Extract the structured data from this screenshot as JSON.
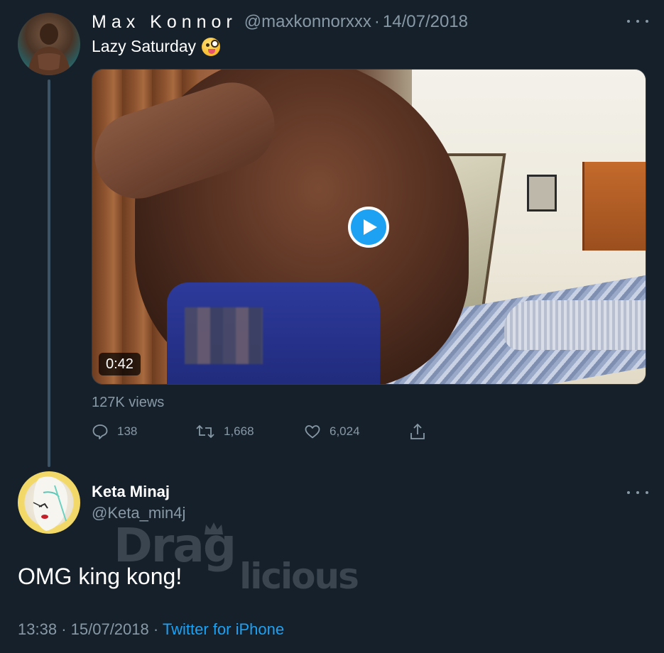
{
  "tweet": {
    "author_name": "Max Konnor",
    "handle": "@maxkonnorxxx",
    "separator": "·",
    "date": "14/07/2018",
    "text": "Lazy Saturday",
    "emoji": "zany-face-emoji",
    "video": {
      "duration": "0:42",
      "views": "127K views"
    },
    "actions": {
      "replies": "138",
      "retweets": "1,668",
      "likes": "6,024"
    }
  },
  "reply": {
    "author_name": "Keta Minaj",
    "handle": "@Keta_min4j",
    "text": "OMG king kong!",
    "time": "13:38",
    "separator": "·",
    "date": "15/07/2018",
    "source_separator": "·",
    "source": "Twitter for iPhone"
  },
  "watermark": {
    "text_top": "Drag",
    "text_bottom": "licious"
  },
  "colors": {
    "background": "#15202b",
    "secondary_text": "#8899a6",
    "accent": "#1da1f2",
    "thread_line": "#3d5466"
  }
}
